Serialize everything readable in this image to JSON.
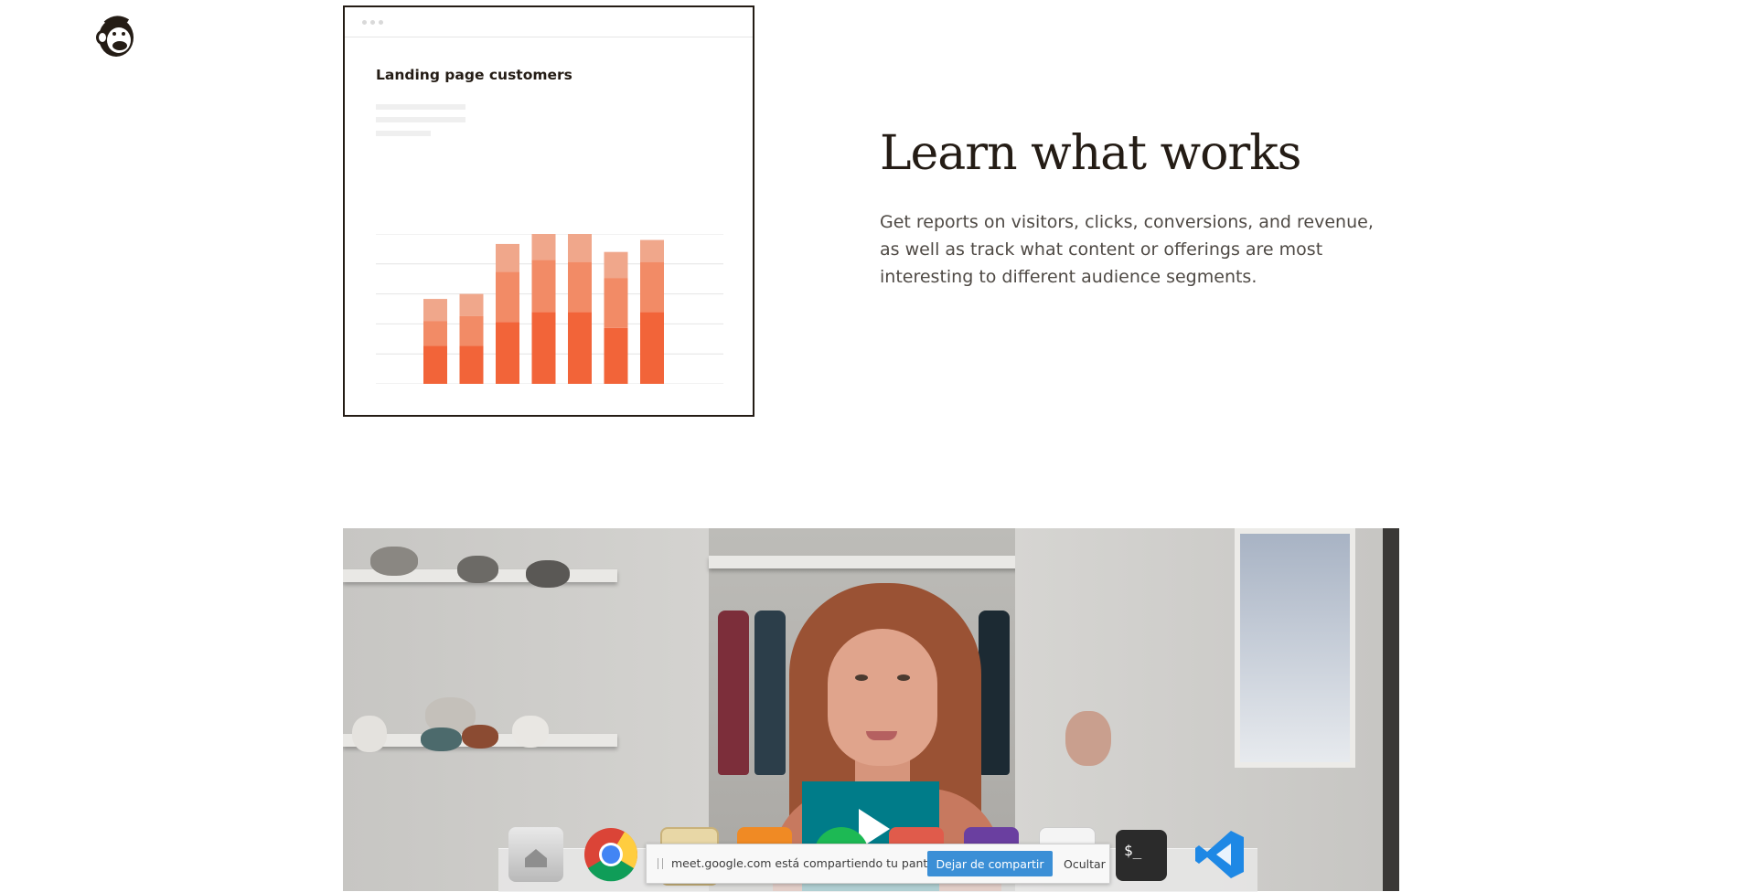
{
  "logo": {
    "icon": "mailchimp-freddie-icon"
  },
  "report_card": {
    "title": "Landing page customers",
    "chart_data": {
      "type": "bar",
      "stacked": true,
      "title": "",
      "xlabel": "",
      "ylabel": "",
      "categories": [
        "",
        "",
        "",
        "",
        "",
        "",
        ""
      ],
      "series": [
        {
          "values": [
            38,
            38,
            62,
            72,
            72,
            56,
            72
          ],
          "color": "#f26439"
        },
        {
          "values": [
            25,
            30,
            50,
            52,
            50,
            50,
            50
          ],
          "color": "#f28b66"
        },
        {
          "values": [
            22,
            22,
            28,
            34,
            30,
            26,
            22
          ],
          "color": "#f0a78b"
        }
      ],
      "ylim": [
        0,
        150
      ],
      "grid": true,
      "legend": "none"
    }
  },
  "feature": {
    "headline": "Learn what works",
    "description": "Get reports on visitors, clicks, conversions, and revenue, as well as track what content or offerings are most interesting to different audience segments."
  },
  "video": {
    "play_icon": "play-icon"
  },
  "dock": {
    "icons": [
      "home-folder-icon",
      "chrome-icon",
      "mail-icon",
      "presentation-icon",
      "spotify-icon",
      "files-icon",
      "photos-icon",
      "calendar-icon",
      "terminal-icon",
      "vscode-icon"
    ]
  },
  "share_bar": {
    "message": "meet.google.com está compartiendo tu pantalla.",
    "stop_label": "Dejar de compartir",
    "hide_label": "Ocultar"
  },
  "colors": {
    "bar_dark": "#f26439",
    "bar_mid": "#f28b66",
    "bar_light": "#f0a78b",
    "play_bg": "#007c89",
    "share_button": "#3b8fd6"
  }
}
